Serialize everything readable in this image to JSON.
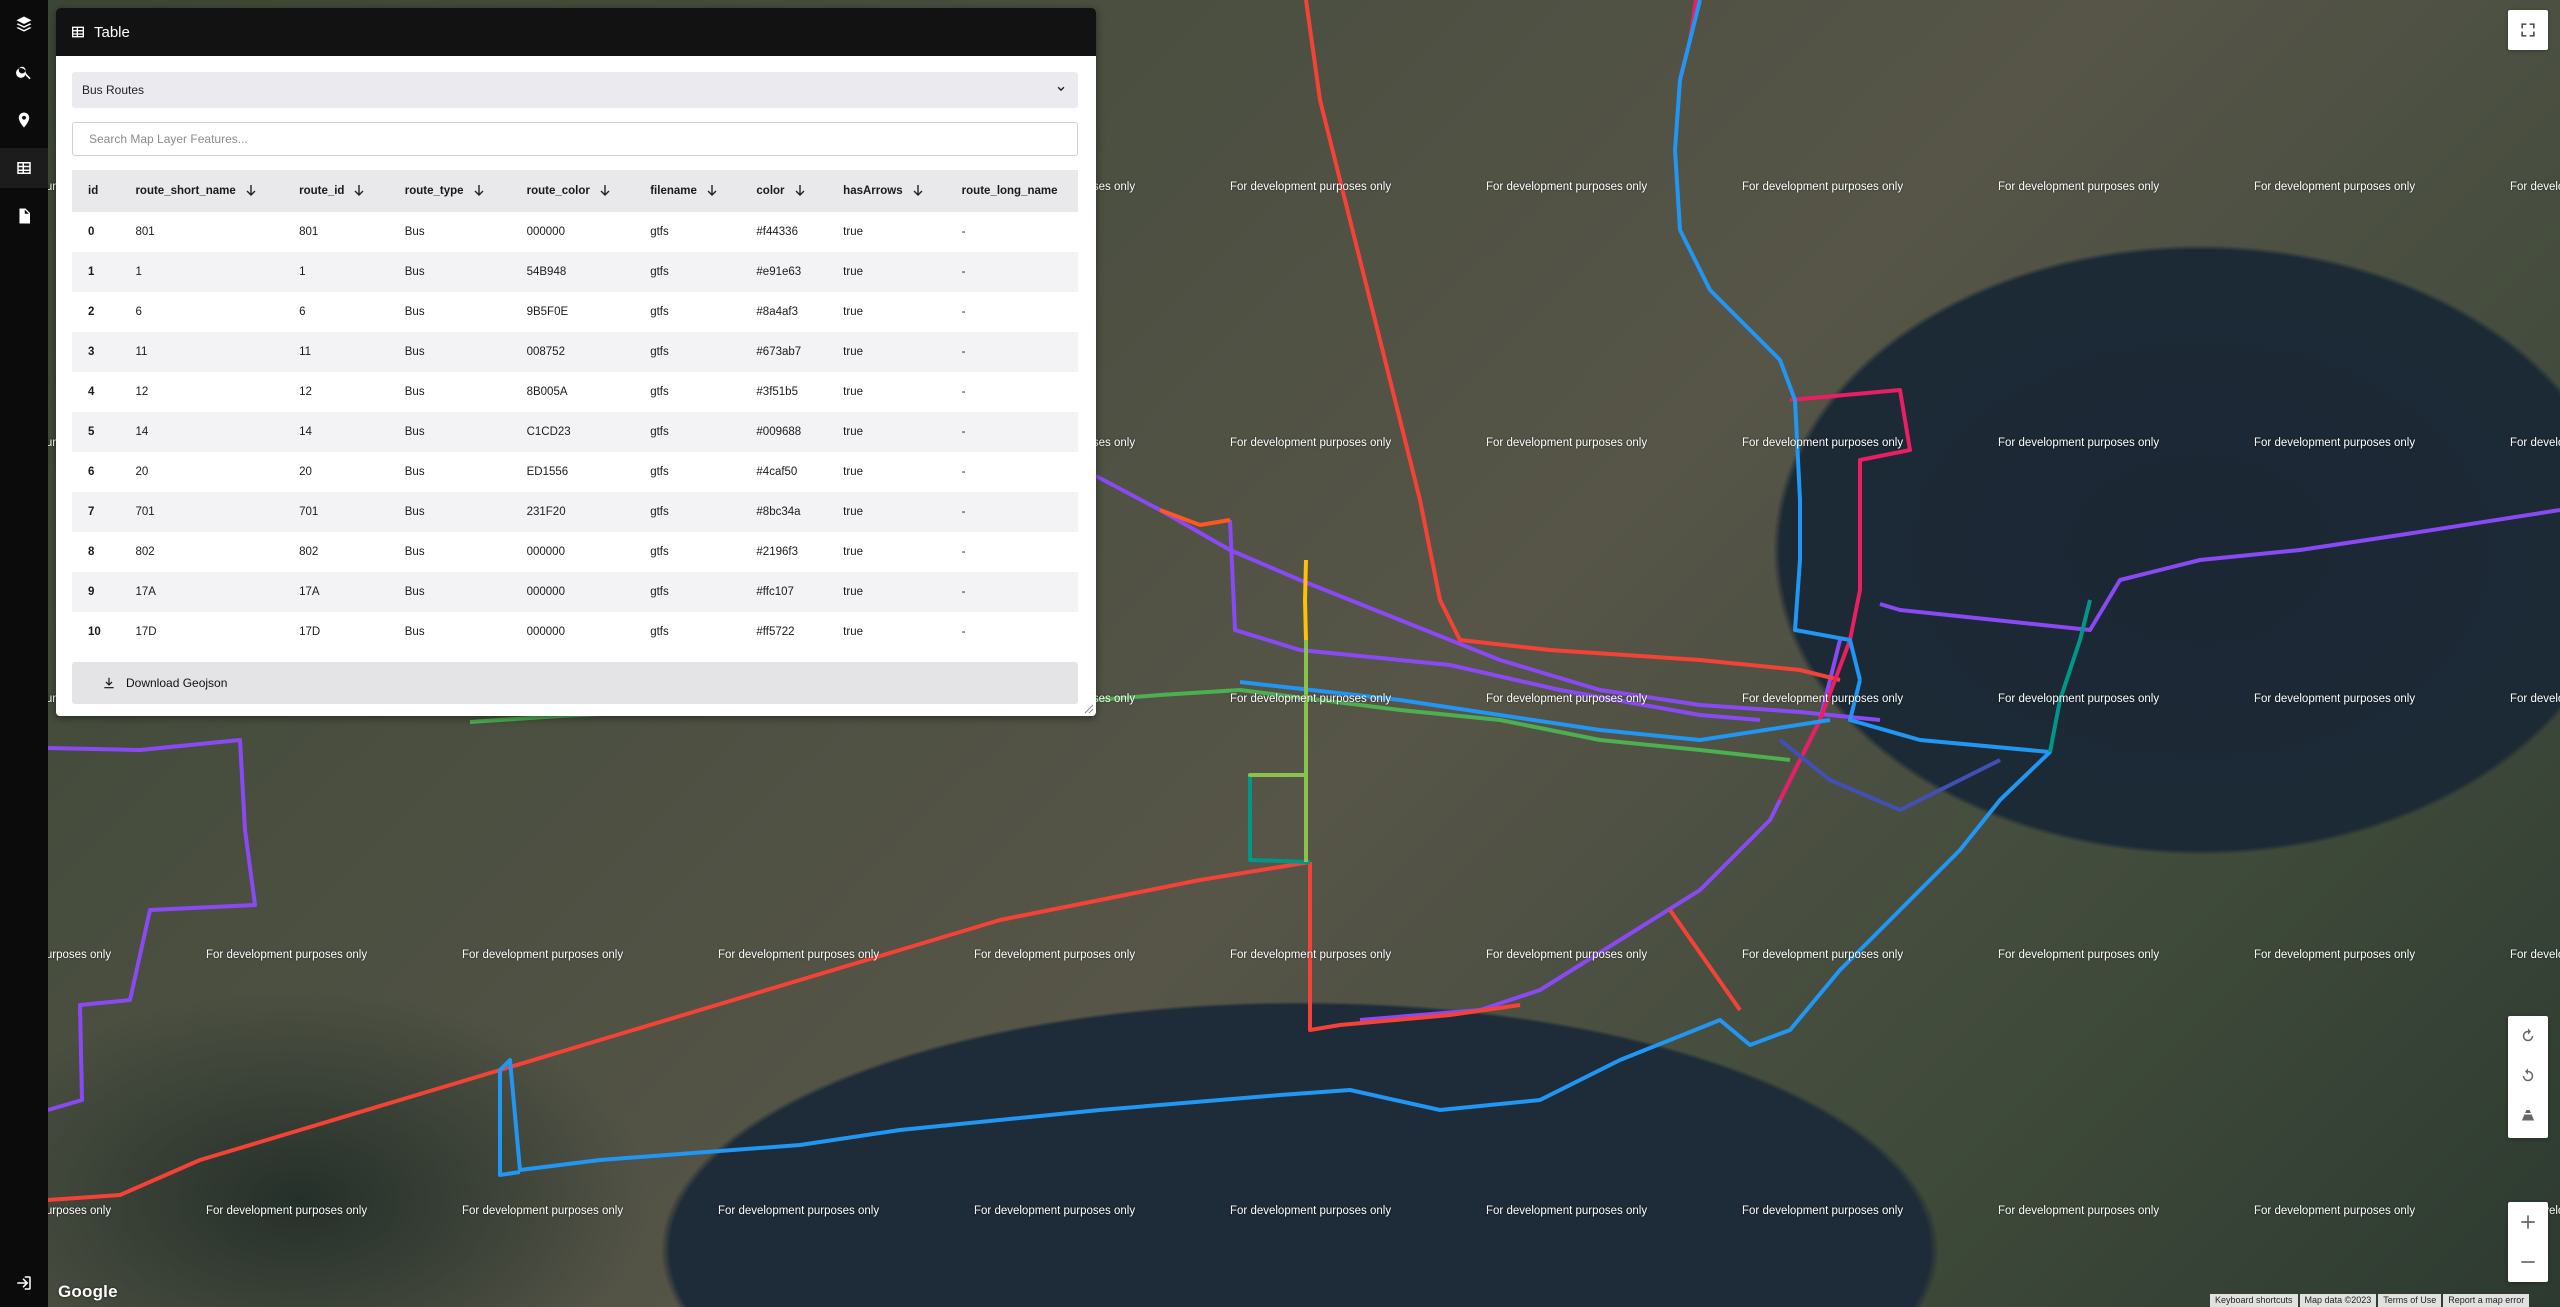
{
  "rail": {
    "items": [
      {
        "icon": "layers-icon"
      },
      {
        "icon": "search-icon"
      },
      {
        "icon": "pin-icon"
      },
      {
        "icon": "table-icon"
      },
      {
        "icon": "document-icon"
      },
      {
        "icon": "logout-icon"
      }
    ]
  },
  "panel": {
    "title": "Table",
    "layer_select": {
      "value": "Bus Routes"
    },
    "search": {
      "placeholder": "Search Map Layer Features..."
    },
    "columns": [
      "id",
      "route_short_name",
      "route_id",
      "route_type",
      "route_color",
      "filename",
      "color",
      "hasArrows",
      "route_long_name"
    ],
    "sortable": [
      false,
      true,
      true,
      true,
      true,
      true,
      true,
      true,
      false
    ],
    "rows": [
      [
        "0",
        "801",
        "801",
        "Bus",
        "000000",
        "gtfs",
        "#f44336",
        "true",
        "-"
      ],
      [
        "1",
        "1",
        "1",
        "Bus",
        "54B948",
        "gtfs",
        "#e91e63",
        "true",
        "-"
      ],
      [
        "2",
        "6",
        "6",
        "Bus",
        "9B5F0E",
        "gtfs",
        "#8a4af3",
        "true",
        "-"
      ],
      [
        "3",
        "11",
        "11",
        "Bus",
        "008752",
        "gtfs",
        "#673ab7",
        "true",
        "-"
      ],
      [
        "4",
        "12",
        "12",
        "Bus",
        "8B005A",
        "gtfs",
        "#3f51b5",
        "true",
        "-"
      ],
      [
        "5",
        "14",
        "14",
        "Bus",
        "C1CD23",
        "gtfs",
        "#009688",
        "true",
        "-"
      ],
      [
        "6",
        "20",
        "20",
        "Bus",
        "ED1556",
        "gtfs",
        "#4caf50",
        "true",
        "-"
      ],
      [
        "7",
        "701",
        "701",
        "Bus",
        "231F20",
        "gtfs",
        "#8bc34a",
        "true",
        "-"
      ],
      [
        "8",
        "802",
        "802",
        "Bus",
        "000000",
        "gtfs",
        "#2196f3",
        "true",
        "-"
      ],
      [
        "9",
        "17A",
        "17A",
        "Bus",
        "000000",
        "gtfs",
        "#ffc107",
        "true",
        "-"
      ],
      [
        "10",
        "17D",
        "17D",
        "Bus",
        "000000",
        "gtfs",
        "#ff5722",
        "true",
        "-"
      ]
    ],
    "download_label": "Download Geojson"
  },
  "map": {
    "watermark_text": "For development purposes only",
    "logo": "Google",
    "attribution": [
      "Keyboard shortcuts",
      "Map data ©2023",
      "Terms of Use",
      "Report a map error"
    ],
    "route_colors": {
      "red": "#f44336",
      "pink": "#e91e63",
      "purple": "#8a4af3",
      "deep_purple": "#673ab7",
      "indigo": "#3f51b5",
      "teal": "#009688",
      "green": "#4caf50",
      "light_green": "#8bc34a",
      "blue": "#2196f3",
      "amber": "#ffc107",
      "orange": "#ff5722"
    }
  }
}
